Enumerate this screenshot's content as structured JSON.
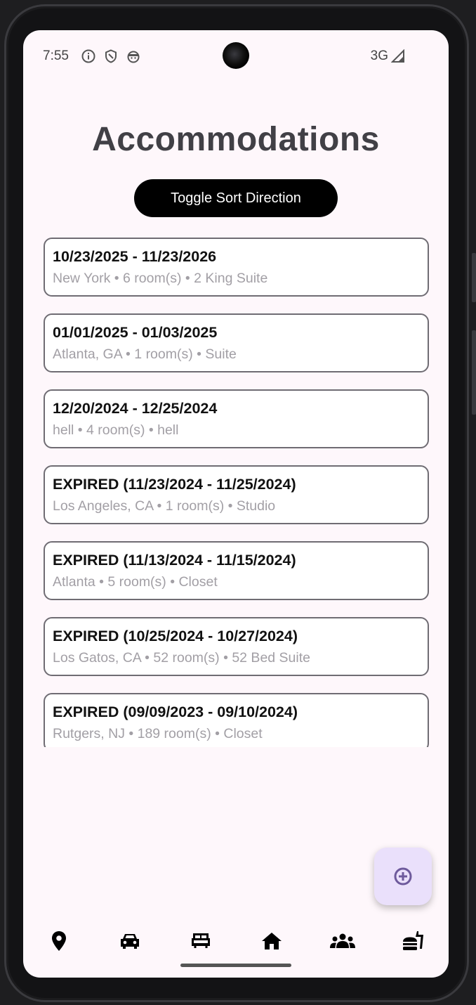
{
  "status_bar": {
    "time": "7:55",
    "icons": [
      "info-icon",
      "shield-icon",
      "android-face-icon"
    ],
    "network": "3G",
    "signal_icon": "cell-signal-icon"
  },
  "header": {
    "title": "Accommodations",
    "sort_button_label": "Toggle Sort Direction"
  },
  "accommodations": [
    {
      "dates": "10/23/2025 - 11/23/2026",
      "meta": "New York • 6 room(s) • 2 King Suite"
    },
    {
      "dates": "01/01/2025 - 01/03/2025",
      "meta": "Atlanta, GA • 1 room(s) • Suite"
    },
    {
      "dates": "12/20/2024 - 12/25/2024",
      "meta": "hell • 4 room(s) • hell"
    },
    {
      "dates": "EXPIRED (11/23/2024 - 11/25/2024)",
      "meta": "Los Angeles, CA • 1 room(s) • Studio"
    },
    {
      "dates": "EXPIRED (11/13/2024 - 11/15/2024)",
      "meta": "Atlanta • 5 room(s) • Closet"
    },
    {
      "dates": "EXPIRED (10/25/2024 - 10/27/2024)",
      "meta": "Los Gatos, CA • 52 room(s) • 52 Bed Suite"
    },
    {
      "dates": "EXPIRED (09/09/2023 - 09/10/2024)",
      "meta": "Rutgers, NJ • 189 room(s) • Closet"
    }
  ],
  "fab": {
    "icon": "add-circle-icon",
    "color": "#6e5a9c"
  },
  "bottom_nav": [
    {
      "id": "location",
      "icon": "location-pin-icon"
    },
    {
      "id": "car",
      "icon": "car-icon"
    },
    {
      "id": "bed",
      "icon": "bed-icon"
    },
    {
      "id": "home",
      "icon": "home-icon"
    },
    {
      "id": "groups",
      "icon": "groups-icon"
    },
    {
      "id": "food",
      "icon": "fastfood-icon"
    }
  ],
  "colors": {
    "screen_bg": "#fef7fb",
    "title": "#414046",
    "card_border": "#6f6c73",
    "meta_text": "#a29fa5",
    "fab_bg": "#eae0fb"
  }
}
